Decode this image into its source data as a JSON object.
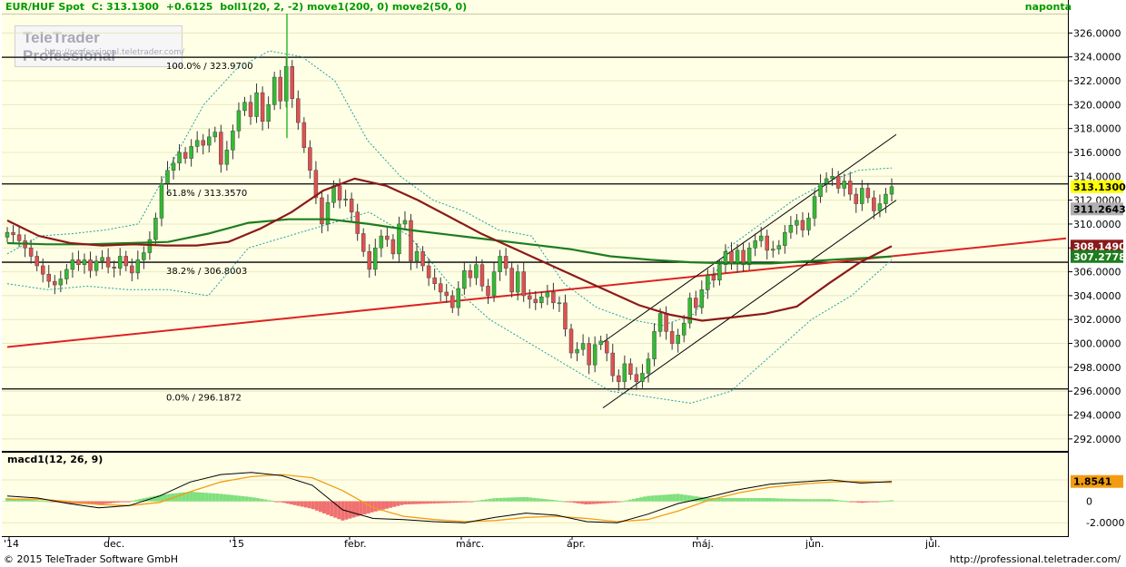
{
  "header": {
    "instrument": "EUR/HUF Spot",
    "close_text": "C: 313.1300",
    "change_text": "+0.6125",
    "indicators": "boll1(20, 2, -2) move1(200, 0) move2(50, 0)",
    "period": "naponta"
  },
  "logo": {
    "line1": "TeleTrader Professional",
    "line2": "http://professional.teletrader.com/"
  },
  "macd": {
    "label": "macd1(12, 26, 9)",
    "current": "1.8541",
    "yticks": [
      "2.0000",
      "0",
      "-2.0000"
    ]
  },
  "footer": {
    "copyright": "© 2015 TeleTrader Software GmbH",
    "url": "http://professional.teletrader.com/"
  },
  "colors": {
    "candle_up": "#33bb33",
    "candle_down": "#e05050",
    "ma50": "#8b1a1a",
    "ma200": "#1e7d1e",
    "trend": "#dd2222",
    "boll": "#20a0a0"
  },
  "chart_data": {
    "type": "candlestick",
    "title": "EUR/HUF Spot",
    "y_range": [
      291.0,
      327.7
    ],
    "y_ticks": [
      "326.0000",
      "324.0000",
      "322.0000",
      "320.0000",
      "318.0000",
      "316.0000",
      "314.0000",
      "312.0000",
      "310.0000",
      "308.0000",
      "306.0000",
      "304.0000",
      "302.0000",
      "300.0000",
      "298.0000",
      "296.0000",
      "294.0000",
      "292.0000"
    ],
    "x_labels": [
      "'14",
      "dec.",
      "'15",
      "febr.",
      "márc.",
      "ápr.",
      "máj.",
      "jún.",
      "júl."
    ],
    "fib_levels": [
      {
        "label": "100.0% / 323.9700",
        "value": 323.97
      },
      {
        "label": "61.8% / 313.3570",
        "value": 313.357
      },
      {
        "label": "38.2% / 306.8003",
        "value": 306.8003
      },
      {
        "label": "0.0% / 296.1872",
        "value": 296.1872
      }
    ],
    "price_tags": [
      {
        "text": "313.1300",
        "value": 313.13,
        "bg": "#ffff00",
        "fg": "#000000"
      },
      {
        "text": "311.2643",
        "value": 311.2643,
        "bg": "#b0b0b0",
        "fg": "#000000"
      },
      {
        "text": "308.1490",
        "value": 308.149,
        "bg": "#8b1a1a",
        "fg": "#ffffff"
      },
      {
        "text": "307.2778",
        "value": 307.2778,
        "bg": "#1e7d1e",
        "fg": "#ffffff"
      }
    ],
    "close_series": [
      309.3,
      309.1,
      308.6,
      308.0,
      307.3,
      306.5,
      305.8,
      305.2,
      304.9,
      305.4,
      306.2,
      307.0,
      306.6,
      307.0,
      306.1,
      306.9,
      307.2,
      306.4,
      306.3,
      307.3,
      306.5,
      305.9,
      307.0,
      307.6,
      308.7,
      310.5,
      313.4,
      314.5,
      315.1,
      316.0,
      315.5,
      316.5,
      317.0,
      316.6,
      317.3,
      317.7,
      315.0,
      316.2,
      317.8,
      319.5,
      320.2,
      319.0,
      321.0,
      318.6,
      320.0,
      322.3,
      320.3,
      323.2,
      320.5,
      318.5,
      316.4,
      314.5,
      312.2,
      310.0,
      311.8,
      313.2,
      312.0,
      312.1,
      311.0,
      309.2,
      307.7,
      306.2,
      308.0,
      309.0,
      308.7,
      307.5,
      310.0,
      310.3,
      306.9,
      307.7,
      306.5,
      305.5,
      305.0,
      304.3,
      304.0,
      303.0,
      304.6,
      306.1,
      305.5,
      306.6,
      304.8,
      304.0,
      306.0,
      307.3,
      306.3,
      304.3,
      306.0,
      304.0,
      303.7,
      303.4,
      303.9,
      304.3,
      303.4,
      303.4,
      301.2,
      299.2,
      299.5,
      300.0,
      298.2,
      299.9,
      300.2,
      299.2,
      297.3,
      296.8,
      298.3,
      297.4,
      296.8,
      297.5,
      298.7,
      301.0,
      302.5,
      301.0,
      300.0,
      300.7,
      301.7,
      303.8,
      303.0,
      304.5,
      305.7,
      305.3,
      306.6,
      307.7,
      306.7,
      307.8,
      306.6,
      308.0,
      308.6,
      309.0,
      307.8,
      307.9,
      308.2,
      309.3,
      309.9,
      310.3,
      309.5,
      310.5,
      312.3,
      313.4,
      313.8,
      314.0,
      313.0,
      313.6,
      312.5,
      311.7,
      313.0,
      312.2,
      311.1,
      311.7,
      312.5,
      313.13
    ],
    "ma50": [
      310.3,
      309.0,
      308.4,
      308.2,
      308.3,
      308.2,
      308.2,
      308.5,
      309.6,
      311.0,
      312.8,
      313.8,
      313.2,
      312.0,
      310.6,
      309.2,
      308.0,
      306.8,
      305.6,
      304.4,
      303.2,
      302.4,
      301.9,
      302.2,
      302.5,
      303.1,
      305.0,
      306.8,
      308.15
    ],
    "ma200": [
      308.4,
      308.3,
      308.3,
      308.4,
      308.5,
      309.2,
      310.1,
      310.4,
      310.4,
      310.0,
      309.5,
      309.1,
      308.7,
      308.3,
      307.9,
      307.3,
      307.0,
      306.8,
      306.7,
      306.7,
      306.9,
      307.1,
      307.28
    ],
    "boll_upper": [
      307.5,
      309.0,
      309.2,
      309.5,
      310.0,
      315.0,
      320.0,
      323.0,
      324.5,
      324.0,
      322.0,
      317.0,
      314.0,
      312.0,
      311.0,
      309.5,
      309.0,
      305.0,
      303.0,
      302.0,
      301.5,
      302.5,
      308.0,
      310.0,
      312.0,
      313.5,
      314.5,
      314.7
    ],
    "boll_lower": [
      305.0,
      304.5,
      304.8,
      304.5,
      304.5,
      304.0,
      308.0,
      309.0,
      310.0,
      311.0,
      309.0,
      305.0,
      302.0,
      300.0,
      298.0,
      296.0,
      295.5,
      295.0,
      296.0,
      299.0,
      302.0,
      304.0,
      307.0
    ],
    "trendline": [
      [
        0,
        299.7
      ],
      [
        1174,
        308.8
      ]
    ],
    "macd_line": [
      0.5,
      0.3,
      -0.2,
      -0.6,
      -0.4,
      0.5,
      1.8,
      2.5,
      2.7,
      2.4,
      1.5,
      -0.8,
      -1.6,
      -1.7,
      -1.9,
      -2.0,
      -1.5,
      -1.1,
      -1.3,
      -1.9,
      -2.0,
      -1.2,
      -0.2,
      0.4,
      1.1,
      1.6,
      1.8,
      2.0,
      1.7,
      1.85
    ],
    "signal_line": [
      0.2,
      0.2,
      0.0,
      -0.3,
      -0.4,
      -0.1,
      0.9,
      1.8,
      2.3,
      2.5,
      2.2,
      1.0,
      -0.6,
      -1.4,
      -1.7,
      -1.9,
      -1.8,
      -1.5,
      -1.4,
      -1.6,
      -1.9,
      -1.7,
      -0.9,
      0.1,
      0.8,
      1.3,
      1.6,
      1.8,
      1.85,
      1.75
    ]
  }
}
